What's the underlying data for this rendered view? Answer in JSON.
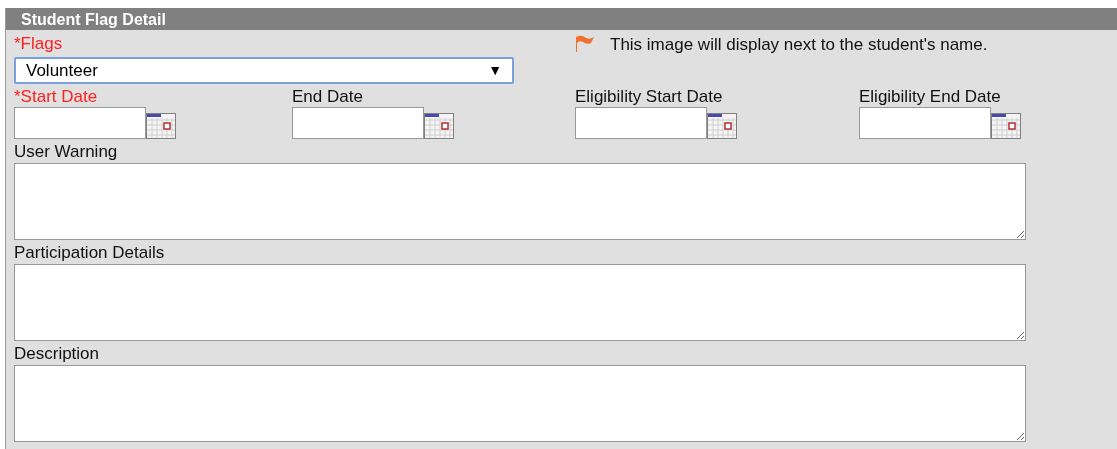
{
  "panel": {
    "title": "Student Flag Detail"
  },
  "flags": {
    "label": "*Flags",
    "required": true,
    "value": "Volunteer",
    "arrow": "▼",
    "focused": true
  },
  "flag_note": "This image will display next to the student's name.",
  "dates": [
    {
      "label": "*Start Date",
      "required": true
    },
    {
      "label": "End Date",
      "required": false
    },
    {
      "label": "Eligibility Start Date",
      "required": false
    },
    {
      "label": "Eligibility End Date",
      "required": false
    }
  ],
  "text_areas": [
    {
      "label": "User Warning"
    },
    {
      "label": "Participation Details"
    },
    {
      "label": "Description"
    }
  ]
}
